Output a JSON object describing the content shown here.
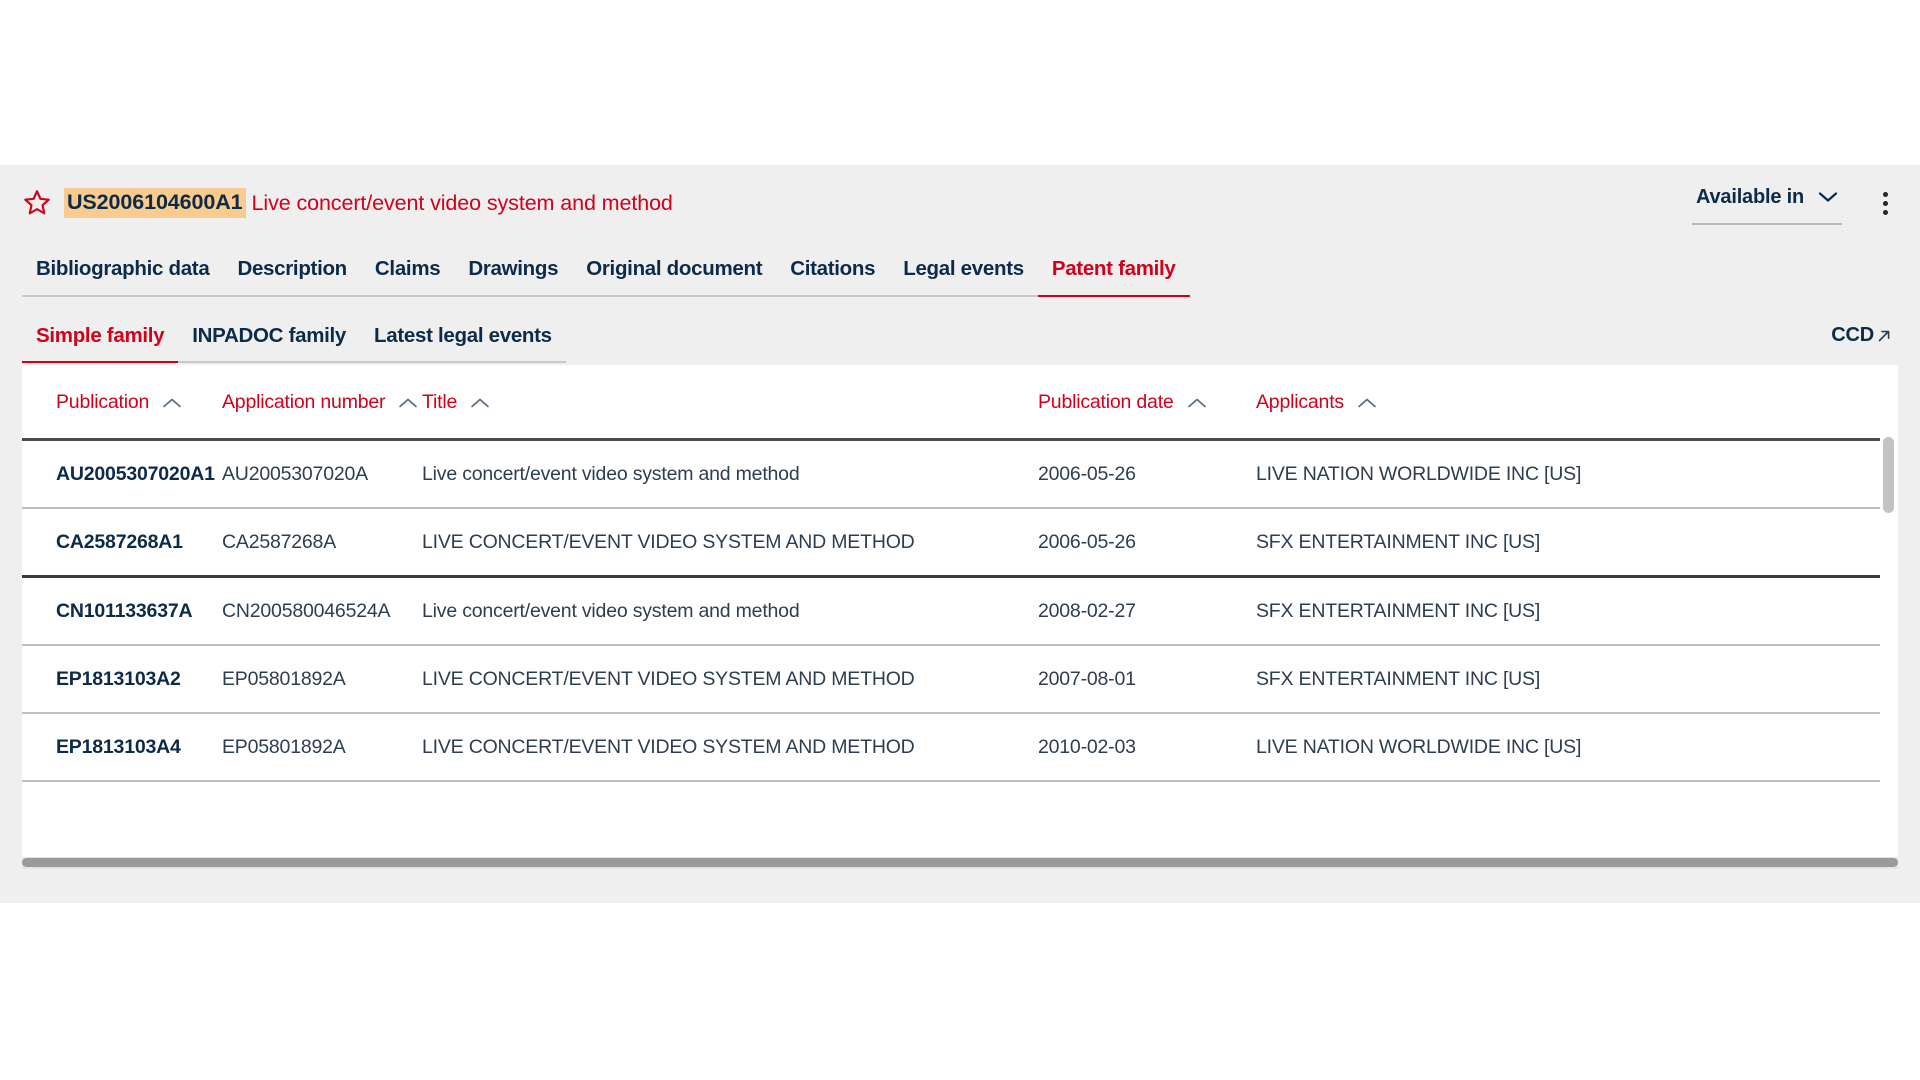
{
  "header": {
    "star_icon": "star-outline-icon",
    "doc_number": "US2006104600A1",
    "doc_title": "Live concert/event video system and method",
    "available_in_label": "Available in",
    "chevron_icon": "chevron-down-icon",
    "kebab_icon": "more-vertical-icon",
    "accent_red": "#d0021b",
    "navy": "#0d2b49",
    "highlight_bg": "#f7cc8e"
  },
  "primary_tabs": [
    {
      "label": "Bibliographic data",
      "active": false
    },
    {
      "label": "Description",
      "active": false
    },
    {
      "label": "Claims",
      "active": false
    },
    {
      "label": "Drawings",
      "active": false
    },
    {
      "label": "Original document",
      "active": false
    },
    {
      "label": "Citations",
      "active": false
    },
    {
      "label": "Legal events",
      "active": false
    },
    {
      "label": "Patent family",
      "active": true
    }
  ],
  "secondary_tabs": [
    {
      "label": "Simple family",
      "active": true
    },
    {
      "label": "INPADOC family",
      "active": false
    },
    {
      "label": "Latest legal events",
      "active": false
    }
  ],
  "ccd": {
    "label": "CCD",
    "icon": "external-link-icon"
  },
  "table": {
    "sort_icon": "caret-up-icon",
    "columns": [
      {
        "label": "Publication",
        "key": "publication"
      },
      {
        "label": "Application number",
        "key": "application_number"
      },
      {
        "label": "Title",
        "key": "title"
      },
      {
        "label": "Publication date",
        "key": "publication_date"
      },
      {
        "label": "Applicants",
        "key": "applicants"
      }
    ],
    "rows": [
      {
        "publication": "AU2005307020A1",
        "application_number": "AU2005307020A",
        "title": "Live concert/event video system and method",
        "publication_date": "2006-05-26",
        "applicants": "LIVE NATION WORLDWIDE INC [US]"
      },
      {
        "publication": "CA2587268A1",
        "application_number": "CA2587268A",
        "title": "LIVE CONCERT/EVENT VIDEO SYSTEM AND METHOD",
        "publication_date": "2006-05-26",
        "applicants": "SFX ENTERTAINMENT INC [US]"
      },
      {
        "publication": "CN101133637A",
        "application_number": "CN200580046524A",
        "title": "Live concert/event video system and method",
        "publication_date": "2008-02-27",
        "applicants": "SFX ENTERTAINMENT INC [US]"
      },
      {
        "publication": "EP1813103A2",
        "application_number": "EP05801892A",
        "title": "LIVE CONCERT/EVENT VIDEO SYSTEM AND METHOD",
        "publication_date": "2007-08-01",
        "applicants": "SFX ENTERTAINMENT INC [US]"
      },
      {
        "publication": "EP1813103A4",
        "application_number": "EP05801892A",
        "title": "LIVE CONCERT/EVENT VIDEO SYSTEM AND METHOD",
        "publication_date": "2010-02-03",
        "applicants": "LIVE NATION WORLDWIDE INC [US]"
      }
    ]
  }
}
